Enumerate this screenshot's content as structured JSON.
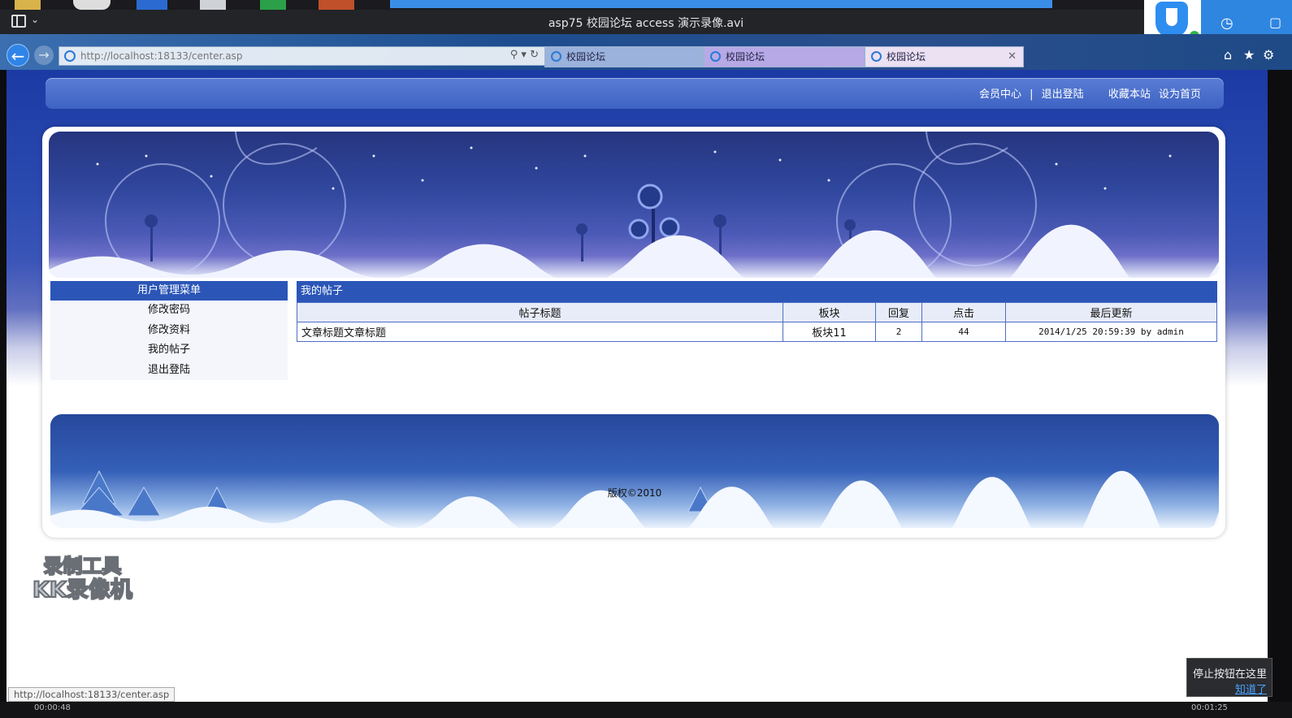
{
  "player": {
    "title": "asp75 校园论坛 access 演示录像.avi",
    "elapsed": "00:00:48",
    "total": "00:01:25"
  },
  "browser": {
    "url": "http://localhost:18133/center.asp",
    "tabs": [
      {
        "label": "校园论坛"
      },
      {
        "label": "校园论坛"
      },
      {
        "label": "校园论坛"
      }
    ],
    "status_url": "http://localhost:18133/center.asp"
  },
  "site": {
    "top_links": {
      "member_center": "会员中心",
      "separator": "|",
      "logout": "退出登陆",
      "favorite": "收藏本站",
      "homepage": "设为首页"
    },
    "menu": {
      "header": "用户管理菜单",
      "items": [
        "修改密码",
        "修改资料",
        "我的帖子",
        "退出登陆"
      ]
    },
    "posts": {
      "header": "我的帖子",
      "columns": [
        "帖子标题",
        "板块",
        "回复",
        "点击",
        "最后更新"
      ],
      "rows": [
        {
          "title": "文章标题文章标题",
          "board": "板块11",
          "replies": "2",
          "clicks": "44",
          "updated": "2014/1/25 20:59:39 by admin"
        }
      ]
    },
    "footer": "版权©2010"
  },
  "overlay": {
    "watermark_line1": "录制工具",
    "watermark_line2": "KK录像机",
    "tooltip_text": "停止按钮在这里",
    "tooltip_link": "知道了"
  }
}
